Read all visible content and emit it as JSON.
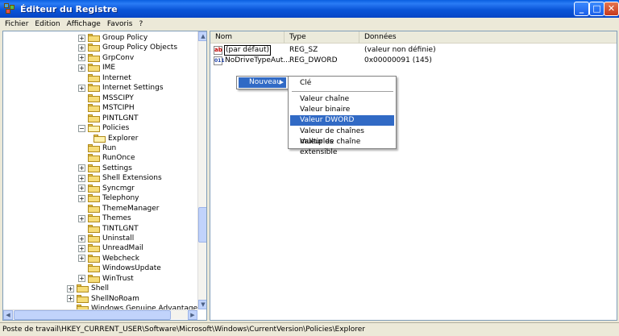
{
  "window": {
    "title": "Éditeur du Registre",
    "minimize": "_",
    "maximize": "□",
    "close": "✕"
  },
  "menubar": [
    "Fichier",
    "Edition",
    "Affichage",
    "Favoris",
    "?"
  ],
  "tree": [
    {
      "label": "Group Policy",
      "expander": "+"
    },
    {
      "label": "Group Policy Objects",
      "expander": "+"
    },
    {
      "label": "GrpConv",
      "expander": "+"
    },
    {
      "label": "IME",
      "expander": "+"
    },
    {
      "label": "Internet",
      "expander": ""
    },
    {
      "label": "Internet Settings",
      "expander": "+"
    },
    {
      "label": "MSSCIPY",
      "expander": ""
    },
    {
      "label": "MSTCIPH",
      "expander": ""
    },
    {
      "label": "PINTLGNT",
      "expander": ""
    },
    {
      "label": "Policies",
      "expander": "−"
    },
    {
      "label": "Explorer",
      "expander": ""
    },
    {
      "label": "Run",
      "expander": ""
    },
    {
      "label": "RunOnce",
      "expander": ""
    },
    {
      "label": "Settings",
      "expander": "+"
    },
    {
      "label": "Shell Extensions",
      "expander": "+"
    },
    {
      "label": "Syncmgr",
      "expander": "+"
    },
    {
      "label": "Telephony",
      "expander": "+"
    },
    {
      "label": "ThemeManager",
      "expander": ""
    },
    {
      "label": "Themes",
      "expander": "+"
    },
    {
      "label": "TINTLGNT",
      "expander": ""
    },
    {
      "label": "Uninstall",
      "expander": "+"
    },
    {
      "label": "UnreadMail",
      "expander": "+"
    },
    {
      "label": "Webcheck",
      "expander": "+"
    },
    {
      "label": "WindowsUpdate",
      "expander": ""
    },
    {
      "label": "WinTrust",
      "expander": "+"
    },
    {
      "label": "Shell",
      "expander": "+"
    },
    {
      "label": "ShellNoRoam",
      "expander": "+"
    },
    {
      "label": "Windows Genuine Advantage",
      "expander": ""
    }
  ],
  "list": {
    "columns": [
      "Nom",
      "Type",
      "Données"
    ],
    "rows": [
      {
        "name": "(par défaut)",
        "type": "REG_SZ",
        "data": "(valeur non définie)",
        "icon": "ab"
      },
      {
        "name": "NoDriveTypeAut...",
        "type": "REG_DWORD",
        "data": "0x00000091 (145)",
        "icon": "011"
      }
    ]
  },
  "context_menu": {
    "parent_item": "Nouveau",
    "arrow": "▶",
    "items": [
      "Clé",
      "Valeur chaîne",
      "Valeur binaire",
      "Valeur DWORD",
      "Valeur de chaînes multiples",
      "Valeur de chaîne extensible"
    ],
    "selected": "Valeur DWORD"
  },
  "scroll_arrows": {
    "up": "▲",
    "down": "▼",
    "left": "◀",
    "right": "▶"
  },
  "statusbar": "Poste de travail\\HKEY_CURRENT_USER\\Software\\Microsoft\\Windows\\CurrentVersion\\Policies\\Explorer"
}
